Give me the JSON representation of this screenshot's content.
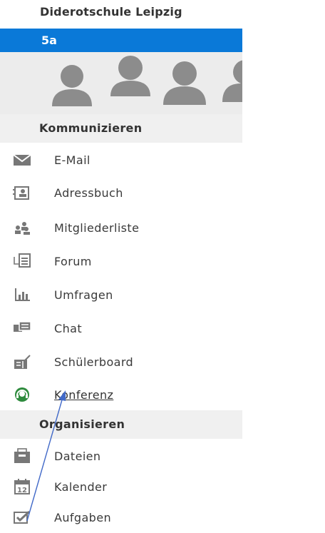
{
  "school_name": "Diderotschule Leipzig",
  "group_name": "5a",
  "colors": {
    "accent": "#0a79d8",
    "icon_gray": "#6f6f6f",
    "conference_green": "#2e8b3d",
    "annotation_arrow": "#4169c8"
  },
  "sections": {
    "communicate": {
      "title": "Kommunizieren",
      "items": [
        {
          "label": "E-Mail",
          "icon": "envelope-icon"
        },
        {
          "label": "Adressbuch",
          "icon": "address-book-icon"
        },
        {
          "label": "Mitgliederliste",
          "icon": "members-icon"
        },
        {
          "label": "Forum",
          "icon": "forum-icon"
        },
        {
          "label": "Umfragen",
          "icon": "poll-chart-icon"
        },
        {
          "label": "Chat",
          "icon": "chat-icon"
        },
        {
          "label": "Schülerboard",
          "icon": "board-icon"
        },
        {
          "label": "Konferenz",
          "icon": "headset-icon",
          "active": true
        }
      ]
    },
    "organize": {
      "title": "Organisieren",
      "items": [
        {
          "label": "Dateien",
          "icon": "folder-icon"
        },
        {
          "label": "Kalender",
          "icon": "calendar-icon",
          "calendar_day": "12"
        },
        {
          "label": "Aufgaben",
          "icon": "task-check-icon"
        }
      ]
    }
  }
}
